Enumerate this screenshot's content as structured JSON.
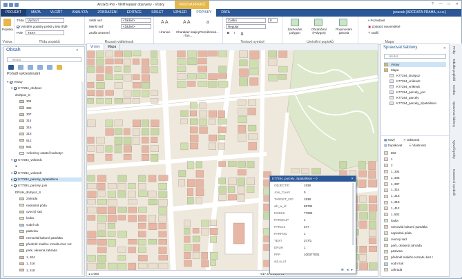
{
  "window": {
    "title": "ArcGIS Pro - VKM katastr obarveny - Vrstvy",
    "context_tab": "VRSTVA PRVKŮ",
    "controls": [
      "?",
      "—",
      "□",
      "✕"
    ]
  },
  "ribbon_tabs": [
    "PROJEKT",
    "MAPA",
    "VLOŽIT",
    "ANALÝZA",
    "ZOBRAZENÍ",
    "EDITACE",
    "SDÍLET",
    "VZHLED",
    "POPISKY",
    "DATA"
  ],
  "user": "jsoucek (ARCDATA PRAHA, s.r.o.)",
  "ribbon": {
    "layer_btn": "Popisky",
    "layer_group": "Vrstva",
    "class_label": "Třída",
    "class_value": "Výchozí",
    "pole_label": "Pole",
    "pole_value": "TEXT",
    "only_selected": "Vytvářet popisky prvků v této třídě",
    "label_class_group": "Třída popisků",
    "greater_than": "Větší než",
    "less_than": "Menší než",
    "out_beyond": "<žádné>",
    "in_beyond": "<žádné>",
    "zoom_limits": "Zrušit omezení",
    "visibility_group": "Rozsah viditelnosti",
    "font_buttons": [
      "Hranice",
      "Charakter krajiny / fun...",
      "Permětrická..."
    ],
    "font_name": "Calibri",
    "font_size": "9",
    "font_style": "Regular",
    "text_symbol_group": "Textový symbol",
    "placement_buttons": [
      "Zachování polygon",
      "Ohraničení (Polygon)",
      "Posunování parcela"
    ],
    "placement_group": "Umístění popisků",
    "map_group": "Mapa",
    "map_items": [
      "Pozastavit",
      "Zobrazit neumístěné",
      "Další"
    ]
  },
  "contents": {
    "title": "Obsah",
    "search_placeholder": "Hledat",
    "draw_order": "Pořadí vykreslování",
    "tree": [
      {
        "label": "Vrstvy",
        "indent": 0,
        "check": true,
        "expand": "▾"
      },
      {
        "label": "K77284_druhpoz",
        "indent": 1,
        "check": true,
        "expand": "▾"
      },
      {
        "label": "druhpoz_S",
        "indent": 2,
        "check": null,
        "expand": ""
      },
      {
        "label": "304",
        "indent": 3,
        "swatch": "#d8cbb4"
      },
      {
        "label": "305",
        "indent": 3,
        "swatch": "#d8cbb4"
      },
      {
        "label": "307",
        "indent": 3,
        "swatch": "#d8cbb4"
      },
      {
        "label": "314",
        "indent": 3,
        "swatch": "#d8cbb4"
      },
      {
        "label": "316",
        "indent": 3,
        "swatch": "#d8cbb4"
      },
      {
        "label": "318",
        "indent": 3,
        "swatch": "#d8cbb4"
      },
      {
        "label": "812",
        "indent": 3,
        "swatch": "#d8cbb4"
      },
      {
        "label": "802",
        "indent": 3,
        "swatch": "#d8cbb4"
      },
      {
        "label": "<všechny ostatní hodnoty>",
        "indent": 3,
        "swatch": "#eee"
      },
      {
        "label": "K77284_vnikredc",
        "indent": 1,
        "check": true,
        "expand": "▾"
      },
      {
        "label": "",
        "indent": 2,
        "dot": true
      },
      {
        "label": "K77284_vnikredt",
        "indent": 1,
        "check": true,
        "expand": "▾"
      },
      {
        "label": "K77284_parcely_Spatiallsion",
        "indent": 1,
        "check": true,
        "expand": "▸",
        "selected": true
      },
      {
        "label": "K77284_parcely_join",
        "indent": 1,
        "check": true,
        "expand": "▾"
      },
      {
        "label": "DRUH_druhpoz_S",
        "indent": 2,
        "check": null,
        "expand": ""
      },
      {
        "label": "zahrada",
        "indent": 3,
        "swatch": "#c6d9a6"
      },
      {
        "label": "neplodná půda",
        "indent": 3,
        "swatch": "#e2d6c2"
      },
      {
        "label": "ovocný sad",
        "indent": 3,
        "swatch": "#bcd39a"
      },
      {
        "label": "louka",
        "indent": 3,
        "swatch": "#d6e6b8"
      },
      {
        "label": "vodní tok",
        "indent": 3,
        "swatch": "#a9cbe6"
      },
      {
        "label": "pastvina",
        "indent": 3,
        "swatch": "#d1e0a8"
      },
      {
        "label": "nemovitá kulturní památka",
        "indent": 3,
        "swatch": "#e8b9a8"
      },
      {
        "label": "předmět malého rozsahu bez roz",
        "indent": 3,
        "swatch": "#e0cfbb"
      },
      {
        "label": "park, okrasná zahrada",
        "indent": 3,
        "swatch": "#b9d59a"
      },
      {
        "label": "1, 304",
        "indent": 3,
        "swatch": "#e8b6a4"
      },
      {
        "label": "1, 316",
        "indent": 3,
        "swatch": "#e8b6a4"
      },
      {
        "label": "1, 318",
        "indent": 3,
        "swatch": "#e8b6a4"
      }
    ]
  },
  "map": {
    "tabs": [
      "Vrstvy",
      "Mapa"
    ],
    "scale": "1:1 000",
    "coords": "-017.476 49,0776"
  },
  "popup": {
    "title": "K77284_parcely_Spatiallsion – 0",
    "fields": [
      {
        "k": "OBJECTID",
        "v": "1538"
      },
      {
        "k": "Join_Count",
        "v": "0"
      },
      {
        "k": "TARGET_FID",
        "v": "1538"
      },
      {
        "k": "wb_w_id",
        "v": "55784"
      },
      {
        "k": "KODKU",
        "v": "77284"
      },
      {
        "k": "PARSKUP",
        "v": "1"
      },
      {
        "k": "PARCIS",
        "v": "377"
      },
      {
        "k": "PARPOD",
        "v": "1"
      },
      {
        "k": "TEXT",
        "v": "377/1"
      },
      {
        "k": "DRUH",
        "v": "1"
      },
      {
        "k": "PPP",
        "v": "100377001"
      },
      {
        "k": "ad_w_id",
        "v": ""
      }
    ]
  },
  "templates": {
    "title": "Spravovat šablony",
    "search_placeholder": "Hledat",
    "tree": [
      "Vrstvy",
      "Mapa",
      "K77284_druhpoz",
      "K77284_vnikredc",
      "K77284_vnikredt",
      "K77284_parcely_join",
      "K77284_parcely",
      "K77284_parcely_Spatiallsion"
    ],
    "actions": [
      "Nový",
      "Odstranit",
      "Duplikovat",
      "Vlastnosti"
    ],
    "list": [
      {
        "label": "802",
        "color": "#f0d8cc"
      },
      {
        "label": "1",
        "color": "#f0d8cc"
      },
      {
        "label": "2",
        "color": "#f0d8cc"
      },
      {
        "label": "1, 304",
        "color": "#f0d8cc"
      },
      {
        "label": "1, 306",
        "color": "#f0d8cc"
      },
      {
        "label": "1, 307",
        "color": "#f0d8cc"
      },
      {
        "label": "1, 314",
        "color": "#f0d8cc"
      },
      {
        "label": "1, 316",
        "color": "#f0d8cc"
      },
      {
        "label": "1, 318",
        "color": "#f0d8cc"
      },
      {
        "label": "1, 412",
        "color": "#f0d8cc"
      },
      {
        "label": "1, 802",
        "color": "#f0d8cc"
      },
      {
        "label": "louka",
        "color": "#dbe8c2"
      },
      {
        "label": "nemovitá kulturní památka",
        "color": "#f0c9bc"
      },
      {
        "label": "neplodná půda",
        "color": "#e8dccb"
      },
      {
        "label": "ovocný sad",
        "color": "#cfe0b0"
      },
      {
        "label": "park, okrasná zahrada",
        "color": "#cfe0b0"
      },
      {
        "label": "pastvina",
        "color": "#d6e6b8"
      },
      {
        "label": "předmět malého rozsahu bez r",
        "color": "#e8dccb"
      },
      {
        "label": "vodní tok",
        "color": "#b8d6ee"
      },
      {
        "label": "zahrada",
        "color": "#d6e6b8"
      }
    ]
  },
  "side_tabs": [
    "Prvky",
    "Tabulka popisků",
    "Kresba",
    "Spravovat šablony",
    "Vytvořit prvky",
    "Nastavení symbolů"
  ],
  "colors": {
    "accent": "#2b5797",
    "parcel_built": "#e8b6a4",
    "parcel_garden": "#c6d9a6",
    "road": "#ffffff",
    "park": "#cfe0b0"
  }
}
